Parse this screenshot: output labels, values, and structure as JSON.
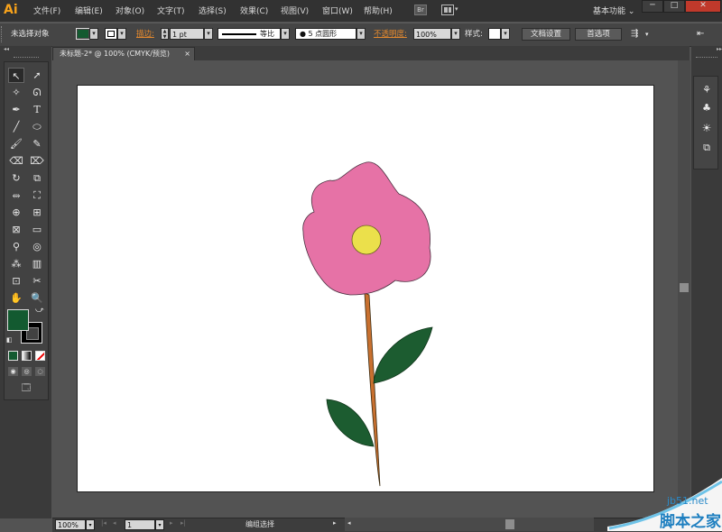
{
  "app": {
    "logo": "Ai",
    "workspace_label": "基本功能",
    "workspace_arrow": "⌄"
  },
  "menu": [
    {
      "label": "文件(F)"
    },
    {
      "label": "编辑(E)"
    },
    {
      "label": "对象(O)"
    },
    {
      "label": "文字(T)"
    },
    {
      "label": "选择(S)"
    },
    {
      "label": "效果(C)"
    },
    {
      "label": "视图(V)"
    },
    {
      "label": "窗口(W)"
    },
    {
      "label": "帮助(H)"
    }
  ],
  "window_controls": {
    "minimize": "─",
    "maximize": "□",
    "close": "✕"
  },
  "control_bar": {
    "selection_label": "未选择对象",
    "stroke_label": "描边:",
    "stroke_weight": "1 pt",
    "profile_label": "等比",
    "brush_label": "5 点圆形",
    "opacity_label": "不透明度:",
    "opacity_value": "100%",
    "style_label": "样式:",
    "doc_setup_button": "文档设置",
    "preferences_button": "首选项"
  },
  "document_tab": {
    "title": "未标题-2* @ 100% (CMYK/预览)",
    "close": "×"
  },
  "colors": {
    "fill": "#135a30",
    "stroke": "#000000",
    "petal": "#e672a6",
    "center": "#ebe04b",
    "stem": "#c8702f",
    "leaf": "#1c5c30",
    "accent_orange": "#e4892e"
  },
  "status_bar": {
    "zoom": "100%",
    "artboard_number": "1",
    "status_text": "编组选择"
  },
  "watermark": {
    "site": "jb51.net",
    "name": "脚本之家"
  }
}
